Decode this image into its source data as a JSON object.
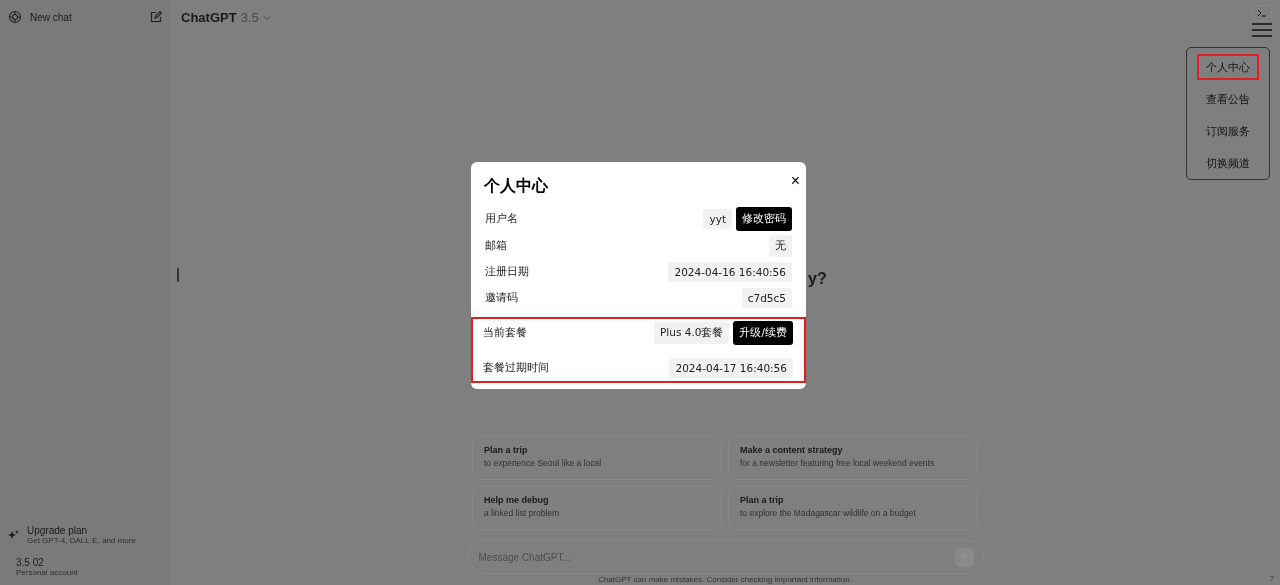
{
  "sidebar": {
    "new_chat": "New chat",
    "upgrade": {
      "title": "Upgrade plan",
      "subtitle": "Get GPT-4, DALL·E, and more"
    },
    "account": {
      "name": "3.5 02",
      "type": "Personal account"
    }
  },
  "header": {
    "model": "ChatGPT",
    "version": "3.5"
  },
  "heading_fragment": "y?",
  "suggestions": [
    {
      "title": "Plan a trip",
      "subtitle": "to experience Seoul like a local"
    },
    {
      "title": "Make a content strategy",
      "subtitle": "for a newsletter featuring free local weekend events"
    },
    {
      "title": "Help me debug",
      "subtitle": "a linked list problem"
    },
    {
      "title": "Plan a trip",
      "subtitle": "to explore the Madagascar wildlife on a budget"
    }
  ],
  "composer": {
    "placeholder": "Message ChatGPT..."
  },
  "footer_note": "ChatGPT can make mistakes. Consider checking important information.",
  "help": "?",
  "menu": {
    "items": [
      {
        "label": "个人中心",
        "selected": true
      },
      {
        "label": "查看公告",
        "selected": false
      },
      {
        "label": "订阅服务",
        "selected": false
      },
      {
        "label": "切换频道",
        "selected": false
      }
    ]
  },
  "modal": {
    "title": "个人中心",
    "close": "×",
    "sections": [
      {
        "highlighted": false,
        "rows": [
          {
            "label": "用户名",
            "value": "yyt",
            "action": "修改密码"
          },
          {
            "label": "邮箱",
            "value": "无"
          },
          {
            "label": "注册日期",
            "value": "2024-04-16 16:40:56"
          },
          {
            "label": "邀请码",
            "value": "c7d5c5"
          }
        ]
      },
      {
        "highlighted": true,
        "rows": [
          {
            "label": "当前套餐",
            "value": "Plus 4.0套餐",
            "action": "升级/续费"
          },
          {
            "label": "套餐过期时间",
            "value": "2024-04-17 16:40:56"
          }
        ]
      }
    ]
  }
}
